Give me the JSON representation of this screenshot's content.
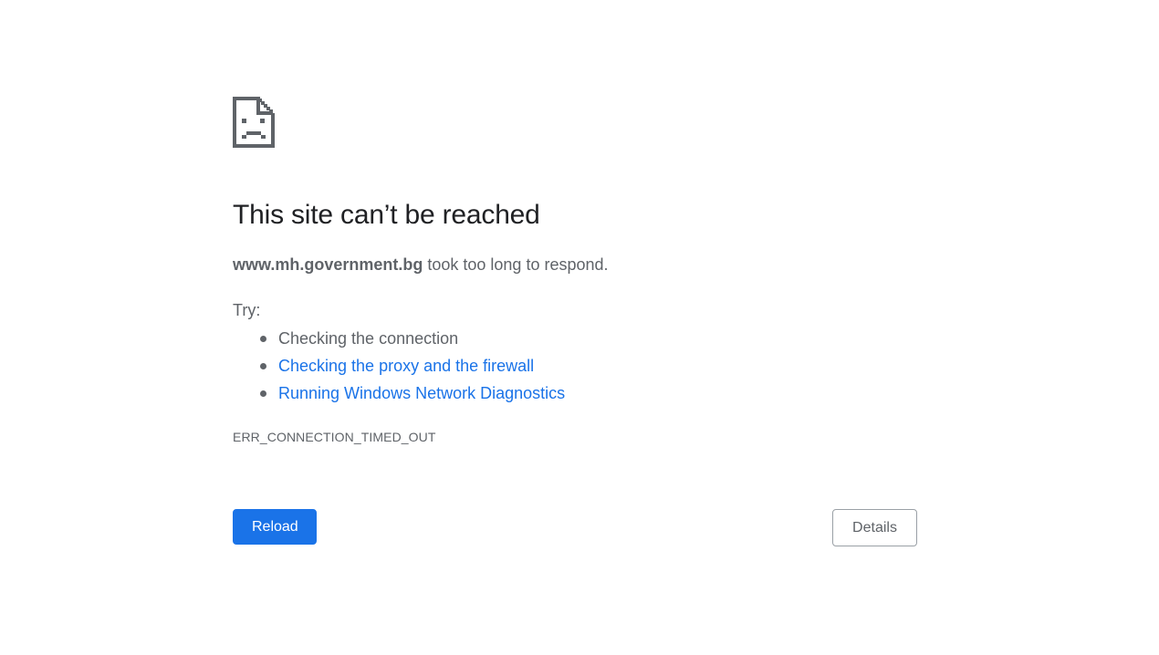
{
  "error_page": {
    "icon": "sad-page-icon",
    "title": "This site can’t be reached",
    "summary": {
      "host": "www.mh.government.bg",
      "message": " took too long to respond."
    },
    "try_label": "Try:",
    "suggestions": [
      {
        "text": "Checking the connection",
        "is_link": false
      },
      {
        "text": "Checking the proxy and the firewall",
        "is_link": true
      },
      {
        "text": "Running Windows Network Diagnostics",
        "is_link": true
      }
    ],
    "error_code": "ERR_CONNECTION_TIMED_OUT",
    "buttons": {
      "reload": "Reload",
      "details": "Details"
    }
  },
  "colors": {
    "accent": "#1a73e8",
    "text_primary": "#202124",
    "text_secondary": "#5f6368",
    "icon": "#5f6368"
  }
}
